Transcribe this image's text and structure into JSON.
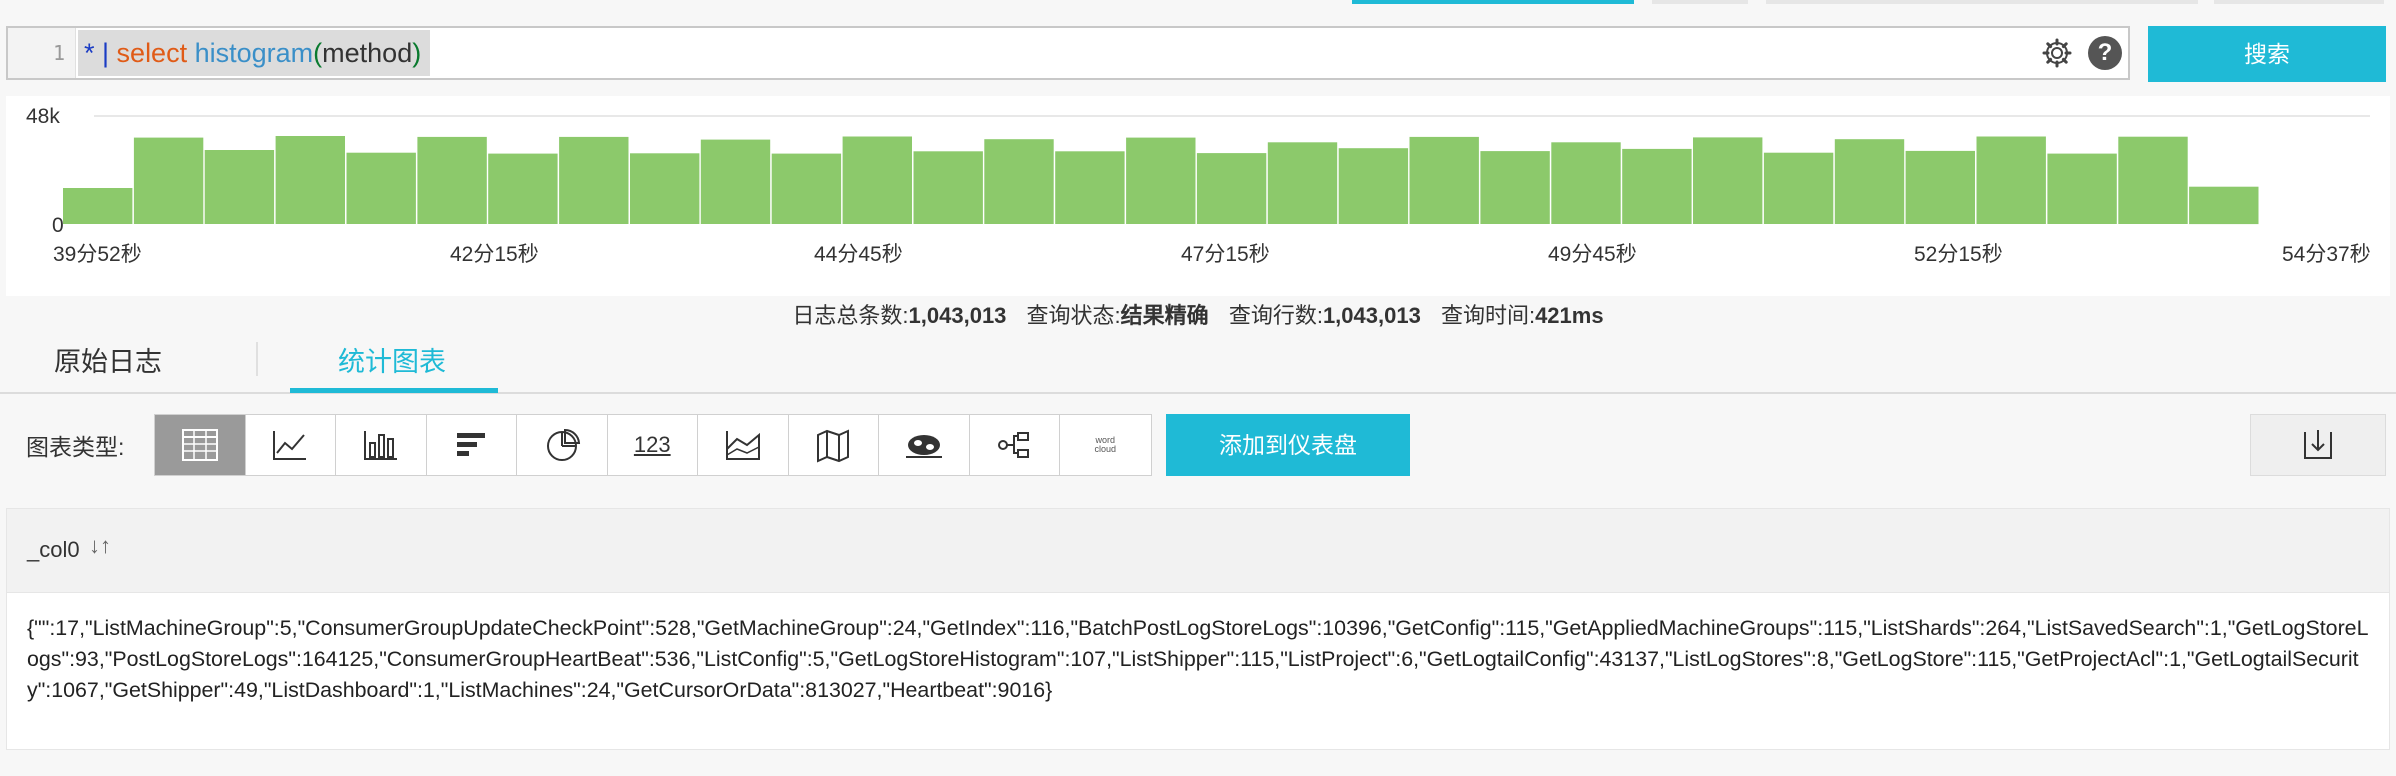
{
  "query": {
    "line_number": "1",
    "tokens": [
      {
        "text": "*",
        "kind": "star"
      },
      {
        "text": " | ",
        "kind": "pipe"
      },
      {
        "text": "select",
        "kind": "kw"
      },
      {
        "text": " histogram",
        "kind": "fn"
      },
      {
        "text": "(",
        "kind": "paren"
      },
      {
        "text": "method",
        "kind": "arg"
      },
      {
        "text": ")",
        "kind": "paren"
      }
    ],
    "help_glyph": "?",
    "search_label": "搜索"
  },
  "chart_data": {
    "type": "bar",
    "ylim": [
      0,
      48000
    ],
    "y_ticks": [
      "48k",
      "0"
    ],
    "x_tick_labels": [
      "39分52秒",
      "42分15秒",
      "44分45秒",
      "47分15秒",
      "49分45秒",
      "52分15秒",
      "54分37秒"
    ],
    "values": [
      16000,
      38400,
      32900,
      39100,
      31700,
      38700,
      31300,
      38700,
      31400,
      37500,
      31300,
      38900,
      32300,
      37700,
      32300,
      38400,
      31500,
      36300,
      33700,
      38700,
      32400,
      36300,
      33400,
      38500,
      31700,
      37700,
      32500,
      38900,
      31300,
      38800,
      16600
    ],
    "bar_color": "#8cc96b"
  },
  "summary": {
    "total_label": "日志总条数:",
    "total_value": "1,043,013",
    "status_label": "查询状态:",
    "status_value": "结果精确",
    "rows_label": "查询行数:",
    "rows_value": "1,043,013",
    "time_label": "查询时间:",
    "time_value": "421ms"
  },
  "tabs": {
    "raw": "原始日志",
    "chart": "统计图表"
  },
  "toolbar": {
    "chart_type_label": "图表类型:",
    "number_glyph": "123",
    "wordcloud_glyph": "word\ncloud",
    "add_label": "添加到仪表盘"
  },
  "result": {
    "column": "_col0",
    "sort_glyph": "↓↑",
    "value": "{\"\":17,\"ListMachineGroup\":5,\"ConsumerGroupUpdateCheckPoint\":528,\"GetMachineGroup\":24,\"GetIndex\":116,\"BatchPostLogStoreLogs\":10396,\"GetConfig\":115,\"GetAppliedMachineGroups\":115,\"ListShards\":264,\"ListSavedSearch\":1,\"GetLogStoreLogs\":93,\"PostLogStoreLogs\":164125,\"ConsumerGroupHeartBeat\":536,\"ListConfig\":5,\"GetLogStoreHistogram\":107,\"ListShipper\":115,\"ListProject\":6,\"GetLogtailConfig\":43137,\"ListLogStores\":8,\"GetLogStore\":115,\"GetProjectAcl\":1,\"GetLogtailSecurity\":1067,\"GetShipper\":49,\"ListDashboard\":1,\"ListMachines\":24,\"GetCursorOrData\":813027,\"Heartbeat\":9016}"
  }
}
